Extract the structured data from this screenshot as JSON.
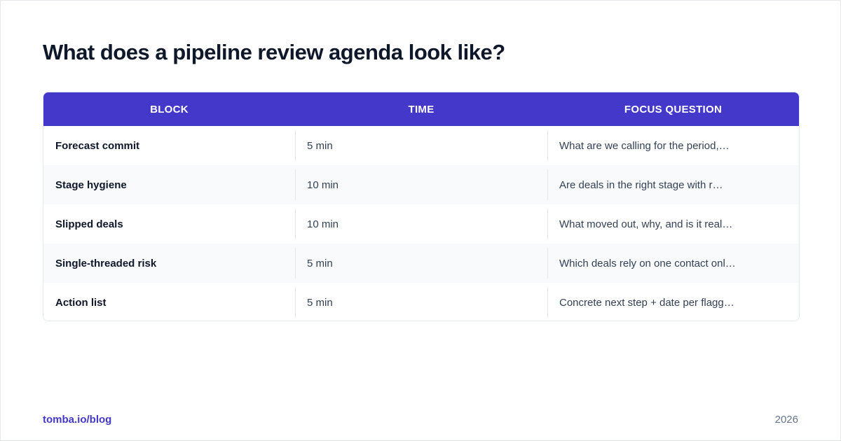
{
  "title": "What does a pipeline review agenda look like?",
  "table": {
    "headers": [
      "BLOCK",
      "TIME",
      "FOCUS QUESTION"
    ],
    "rows": [
      {
        "block": "Forecast commit",
        "time": "5 min",
        "focus": "What are we calling for the period,…"
      },
      {
        "block": "Stage hygiene",
        "time": "10 min",
        "focus": "Are deals in the right stage with r…"
      },
      {
        "block": "Slipped deals",
        "time": "10 min",
        "focus": "What moved out, why, and is it real…"
      },
      {
        "block": "Single-threaded risk",
        "time": "5 min",
        "focus": "Which deals rely on one contact onl…"
      },
      {
        "block": "Action list",
        "time": "5 min",
        "focus": "Concrete next step + date per flagg…"
      }
    ]
  },
  "footer": {
    "link": "tomba.io/blog",
    "year": "2026"
  },
  "colors": {
    "header_bg": "#4338ca",
    "title_text": "#0f172a",
    "link_text": "#4338ca",
    "alt_row_bg": "#f8fafc"
  }
}
